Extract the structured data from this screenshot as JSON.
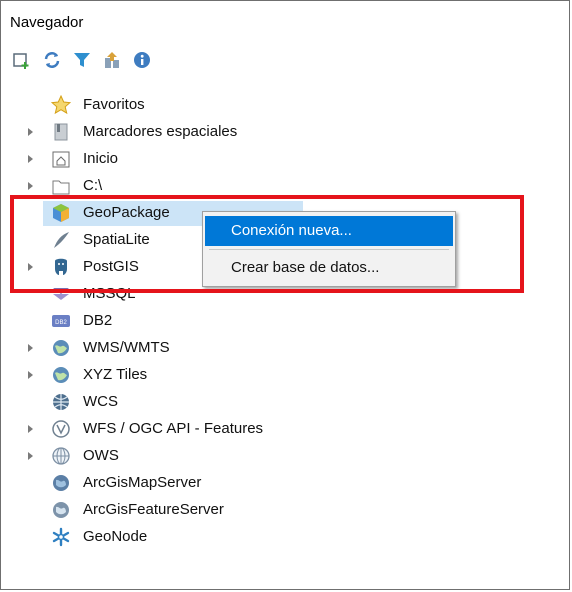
{
  "panel": {
    "title": "Navegador"
  },
  "toolbar": {
    "buttons": [
      "add-layer-icon",
      "refresh-icon",
      "filter-icon",
      "collapse-all-icon",
      "info-icon"
    ]
  },
  "tree": {
    "items": [
      {
        "label": "Favoritos",
        "icon": "star-icon",
        "expandable": false
      },
      {
        "label": "Marcadores espaciales",
        "icon": "bookmark-icon",
        "expandable": true
      },
      {
        "label": "Inicio",
        "icon": "home-folder-icon",
        "expandable": true
      },
      {
        "label": "C:\\",
        "icon": "drive-folder-icon",
        "expandable": true
      },
      {
        "label": "GeoPackage",
        "icon": "geopackage-icon",
        "expandable": false,
        "selected": true
      },
      {
        "label": "SpatiaLite",
        "icon": "spatialite-icon",
        "expandable": false
      },
      {
        "label": "PostGIS",
        "icon": "postgis-icon",
        "expandable": true
      },
      {
        "label": "MSSQL",
        "icon": "mssql-icon",
        "expandable": false
      },
      {
        "label": "DB2",
        "icon": "db2-icon",
        "expandable": false
      },
      {
        "label": "WMS/WMTS",
        "icon": "wms-globe-icon",
        "expandable": true
      },
      {
        "label": "XYZ Tiles",
        "icon": "xyz-globe-icon",
        "expandable": true
      },
      {
        "label": "WCS",
        "icon": "wcs-globe-icon",
        "expandable": false
      },
      {
        "label": "WFS / OGC API - Features",
        "icon": "wfs-globe-icon",
        "expandable": true
      },
      {
        "label": "OWS",
        "icon": "ows-globe-icon",
        "expandable": true
      },
      {
        "label": "ArcGisMapServer",
        "icon": "arcgis-map-icon",
        "expandable": false
      },
      {
        "label": "ArcGisFeatureServer",
        "icon": "arcgis-feature-icon",
        "expandable": false
      },
      {
        "label": "GeoNode",
        "icon": "geonode-icon",
        "expandable": false
      }
    ]
  },
  "context_menu": {
    "items": [
      {
        "label": "Conexión nueva...",
        "highlighted": true
      },
      {
        "label": "Crear base de datos...",
        "highlighted": false
      }
    ]
  },
  "colors": {
    "highlight": "#0078d7",
    "selection": "#cce4f7",
    "annotation": "#e5141b"
  }
}
